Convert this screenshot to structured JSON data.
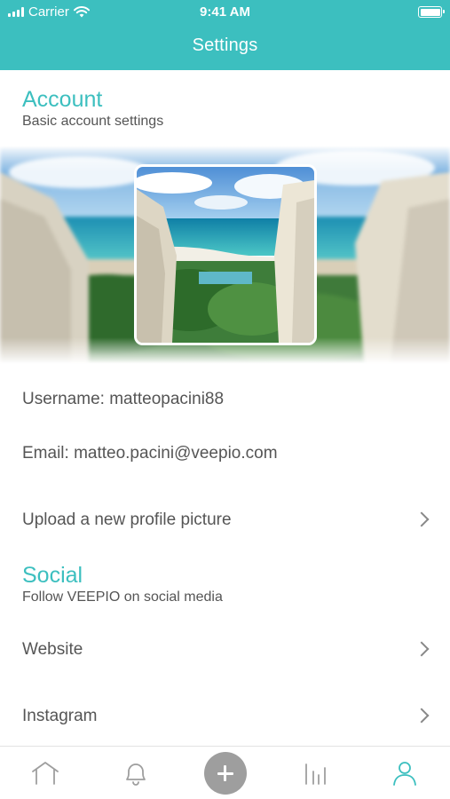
{
  "status_bar": {
    "carrier": "Carrier",
    "time": "9:41 AM",
    "icons": [
      "signal-icon",
      "wifi-icon",
      "battery-icon"
    ]
  },
  "nav": {
    "title": "Settings"
  },
  "account": {
    "title": "Account",
    "subtitle": "Basic account settings",
    "username_label": "Username: matteopacini88",
    "email_label": "Email: matteo.pacini@veepio.com",
    "upload_label": "Upload a new profile picture"
  },
  "social": {
    "title": "Social",
    "subtitle": "Follow VEEPIO on social media",
    "items": [
      {
        "label": "Website"
      },
      {
        "label": "Instagram"
      }
    ]
  },
  "tabbar": {
    "tabs": [
      "home-icon",
      "bell-icon",
      "add-icon",
      "stats-icon",
      "profile-icon"
    ],
    "active": "profile-icon"
  },
  "colors": {
    "accent": "#3cbfbf",
    "text_secondary": "#555555",
    "icon_inactive": "#9e9e9e"
  }
}
